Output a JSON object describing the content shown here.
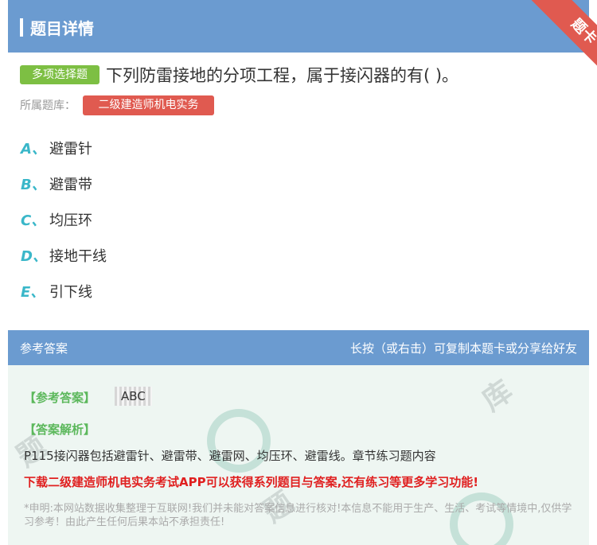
{
  "header": {
    "title": "题目详情",
    "ribbon_label": "题卡"
  },
  "question": {
    "type_tag": "多项选择题",
    "text": "下列防雷接地的分项工程，属于接闪器的有( )。",
    "bank_label": "所属题库：",
    "bank_name": "二级建造师机电实务"
  },
  "options": [
    {
      "letter": "A、",
      "text": "避雷针"
    },
    {
      "letter": "B、",
      "text": "避雷带"
    },
    {
      "letter": "C、",
      "text": "均压环"
    },
    {
      "letter": "D、",
      "text": "接地干线"
    },
    {
      "letter": "E、",
      "text": "引下线"
    }
  ],
  "answer_section": {
    "title": "参考答案",
    "hint": "长按（或右击）可复制本题卡或分享给好友",
    "answer_label": "【参考答案】",
    "answer_value": "ABC",
    "analysis_label": "【答案解析】",
    "analysis_text": "P115接闪器包括避雷针、避雷带、避雷网、均压环、避雷线。章节练习题内容",
    "download_text": "下载二级建造师机电实务考试APP可以获得系列题目与答案,还有练习等更多学习功能!",
    "disclaimer": "*申明:本网站数据收集整理于互联网!我们并未能对答案信息进行核对!本信息不能用于生产、生活、考试等情境中,仅供学习参考！由此产生任何后果本站不承担责任!"
  },
  "colors": {
    "header_bg": "#6b9bd0",
    "tag_green": "#7dbf43",
    "tag_red": "#e05a50",
    "letter_teal": "#3ab7c9"
  }
}
